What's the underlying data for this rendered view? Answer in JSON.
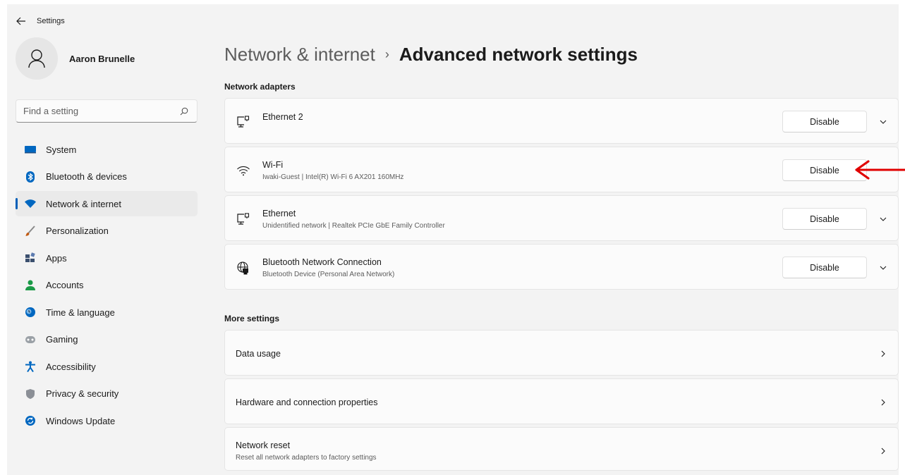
{
  "window": {
    "title": "Settings"
  },
  "profile": {
    "name": "Aaron Brunelle"
  },
  "search": {
    "placeholder": "Find a setting"
  },
  "sidebar": {
    "items": [
      {
        "label": "System",
        "icon": "monitor-icon",
        "color": "#0067c0"
      },
      {
        "label": "Bluetooth & devices",
        "icon": "bluetooth-icon",
        "color": "#0067c0"
      },
      {
        "label": "Network & internet",
        "icon": "wifi-icon",
        "color": "#0067c0",
        "selected": true
      },
      {
        "label": "Personalization",
        "icon": "brush-icon",
        "color": "#c25b13"
      },
      {
        "label": "Apps",
        "icon": "apps-icon",
        "color": "#3b4f6e"
      },
      {
        "label": "Accounts",
        "icon": "person-icon",
        "color": "#1b9a47"
      },
      {
        "label": "Time & language",
        "icon": "globe-clock-icon",
        "color": "#0067c0"
      },
      {
        "label": "Gaming",
        "icon": "gamepad-icon",
        "color": "#7a7a7a"
      },
      {
        "label": "Accessibility",
        "icon": "accessibility-icon",
        "color": "#0067c0"
      },
      {
        "label": "Privacy & security",
        "icon": "shield-icon",
        "color": "#6b6b6b"
      },
      {
        "label": "Windows Update",
        "icon": "update-icon",
        "color": "#0067c0"
      }
    ]
  },
  "breadcrumb": {
    "parent": "Network & internet",
    "separator": "›",
    "current": "Advanced network settings"
  },
  "network_adapters": {
    "title": "Network adapters",
    "items": [
      {
        "name": "Ethernet 2",
        "detail": "",
        "icon": "ethernet-icon",
        "button": "Disable"
      },
      {
        "name": "Wi-Fi",
        "detail": "Iwaki-Guest | Intel(R) Wi-Fi 6 AX201 160MHz",
        "icon": "wifi-icon",
        "button": "Disable"
      },
      {
        "name": "Ethernet",
        "detail": "Unidentified network | Realtek PCIe GbE Family Controller",
        "icon": "ethernet-icon",
        "button": "Disable"
      },
      {
        "name": "Bluetooth Network Connection",
        "detail": "Bluetooth Device (Personal Area Network)",
        "icon": "globe-network-icon",
        "button": "Disable"
      }
    ]
  },
  "more_settings": {
    "title": "More settings",
    "items": [
      {
        "name": "Data usage",
        "detail": ""
      },
      {
        "name": "Hardware and connection properties",
        "detail": ""
      },
      {
        "name": "Network reset",
        "detail": "Reset all network adapters to factory settings"
      }
    ]
  },
  "annotation": {
    "arrow_color": "#e00000"
  }
}
